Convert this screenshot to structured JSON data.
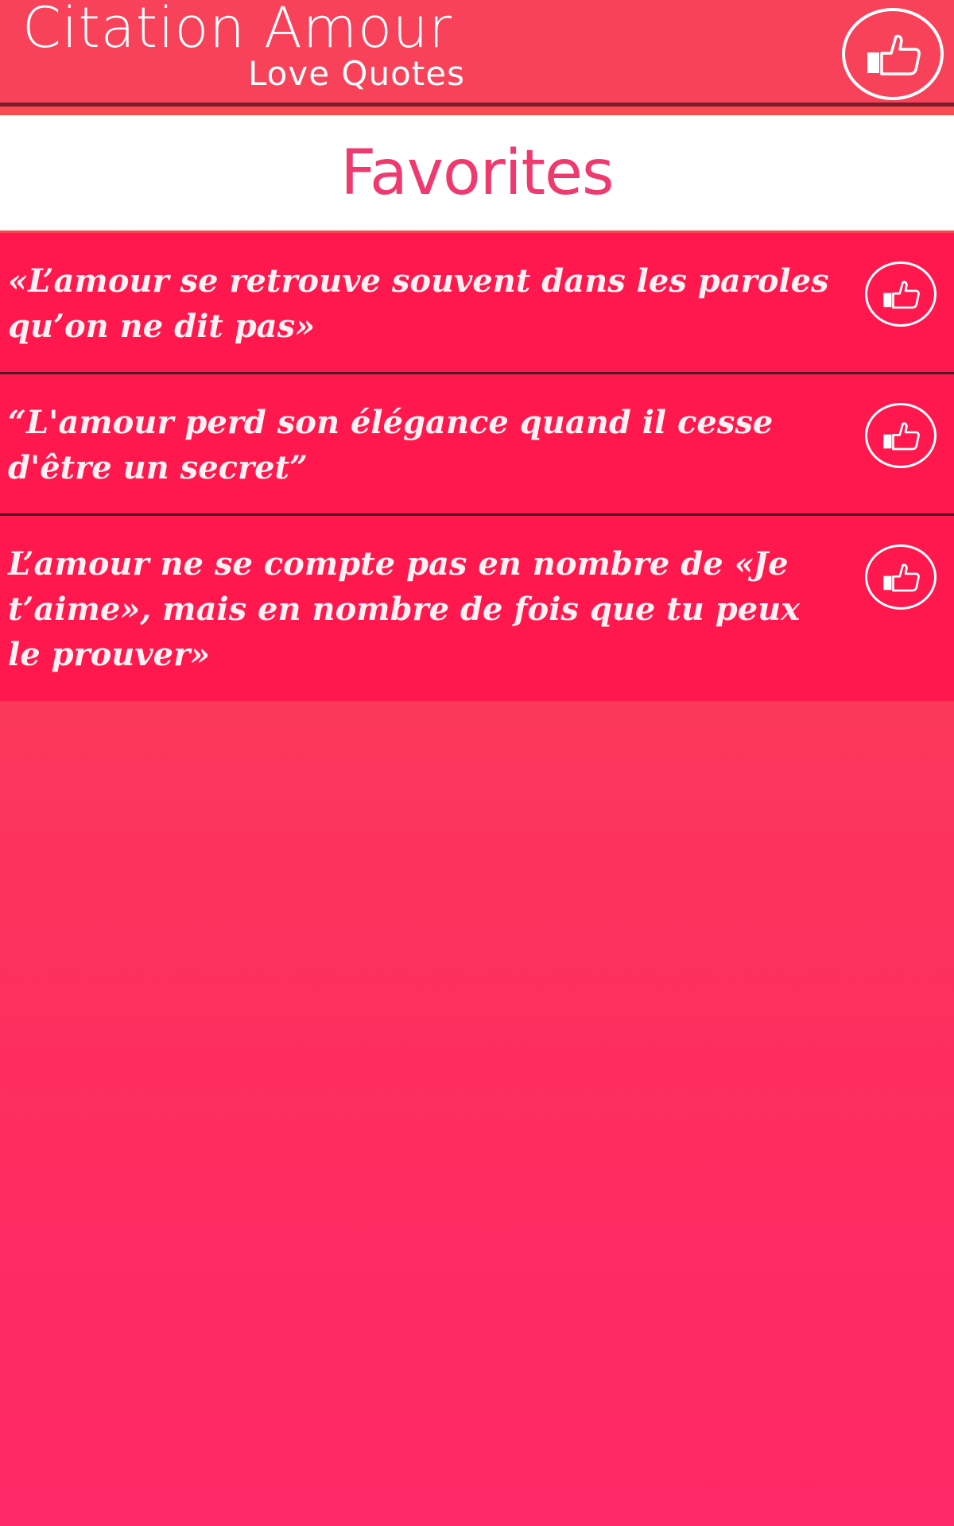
{
  "header": {
    "title": "Citation Amour",
    "subtitle": "Love Quotes",
    "like_icon": "thumbs-up-icon"
  },
  "page": {
    "title": "Favorites"
  },
  "quotes": [
    {
      "text": "«L’amour se retrouve souvent dans les paroles qu’on ne dit pas»",
      "icon": "thumbs-up-icon"
    },
    {
      "text": "“L'amour perd son élégance quand il cesse d'être un secret”",
      "icon": "thumbs-up-icon"
    },
    {
      "text": "L’amour ne se compte pas en nombre de «Je t’aime», mais en nombre de fois que tu peux le prouver»",
      "icon": "thumbs-up-icon"
    }
  ],
  "colors": {
    "header_bg": "#f7425a",
    "favorites_text": "#ee3a6f",
    "quote_bg": "#fe184d",
    "background_top": "#fb4d4d",
    "background_bottom": "#ff2866"
  }
}
